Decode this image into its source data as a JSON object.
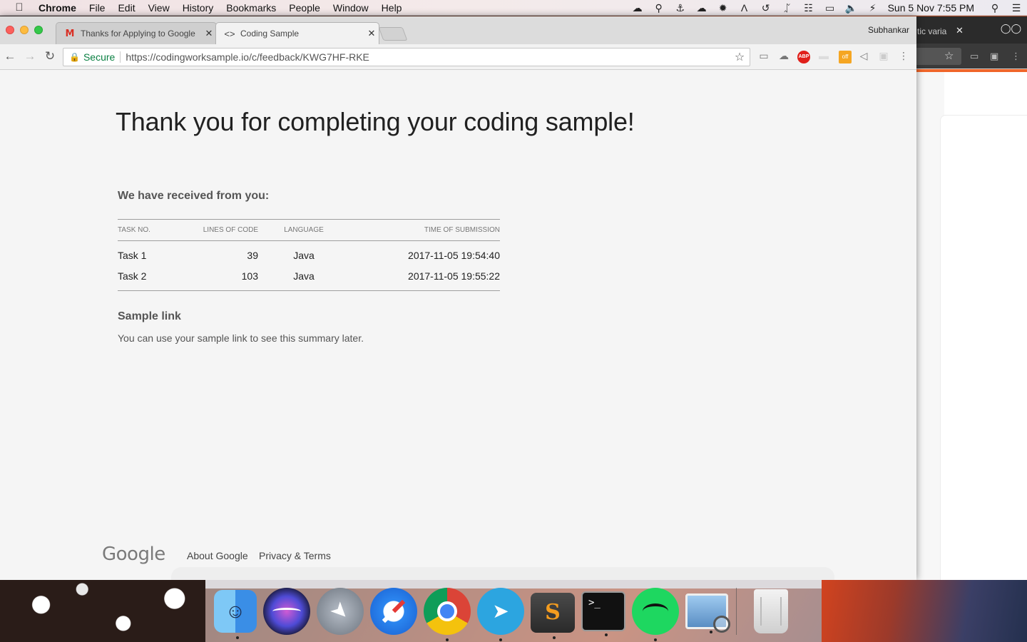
{
  "menubar": {
    "apple": "",
    "items": [
      "Chrome",
      "File",
      "Edit",
      "View",
      "History",
      "Bookmarks",
      "People",
      "Window",
      "Help"
    ],
    "status_icons": [
      "creative-cloud-icon",
      "airport-utility-icon",
      "docker-icon",
      "cloud-sync-icon",
      "gear-plugin-icon",
      "adobe-icon",
      "time-machine-icon",
      "bluetooth-icon",
      "wifi-icon",
      "airplay-icon",
      "volume-icon",
      "battery-icon"
    ],
    "clock": "Sun 5 Nov  7:55 PM"
  },
  "browser": {
    "tabs": [
      {
        "title": "Thanks for Applying to Google",
        "icon": "gmail-icon"
      },
      {
        "title": "Coding Sample",
        "icon": "code-icon",
        "active": true
      }
    ],
    "profile": "Subhankar",
    "omnibox": {
      "secure_label": "Secure",
      "url": "https://codingworksample.io/c/feedback/KWG7HF-RKE"
    },
    "extensions": [
      "cast-icon",
      "drive-icon",
      "adblock-icon",
      "hidden-ext-icon",
      "off-extension-icon",
      "tag-icon",
      "square-ext-icon",
      "menu-icon"
    ],
    "extension_labels": {
      "abp": "ABP",
      "off": "off"
    }
  },
  "background_window": {
    "tab_title": "tic varia"
  },
  "page": {
    "headline": "Thank you for completing your coding sample!",
    "received_heading": "We have received from you:",
    "table": {
      "columns": [
        "Task No.",
        "Lines of code",
        "Language",
        "Time of submission"
      ],
      "rows": [
        [
          "Task 1",
          "39",
          "Java",
          "2017-11-05 19:54:40"
        ],
        [
          "Task 2",
          "103",
          "Java",
          "2017-11-05 19:55:22"
        ]
      ]
    },
    "sample_link_heading": "Sample link",
    "sample_link_note": "You can use your sample link to see this summary later.",
    "footer": {
      "logo": "Google",
      "links": [
        "About Google",
        "Privacy & Terms"
      ]
    }
  },
  "dock": {
    "apps": [
      "Finder",
      "Siri",
      "Launchpad",
      "Safari",
      "Google Chrome",
      "Telegram",
      "Sublime Text",
      "Terminal",
      "Spotify",
      "Preview",
      "Trash"
    ]
  },
  "colors": {
    "secure_green": "#0b8043",
    "text_dark": "#212121",
    "text_muted": "#555555",
    "page_bg": "#f5f5f5"
  }
}
